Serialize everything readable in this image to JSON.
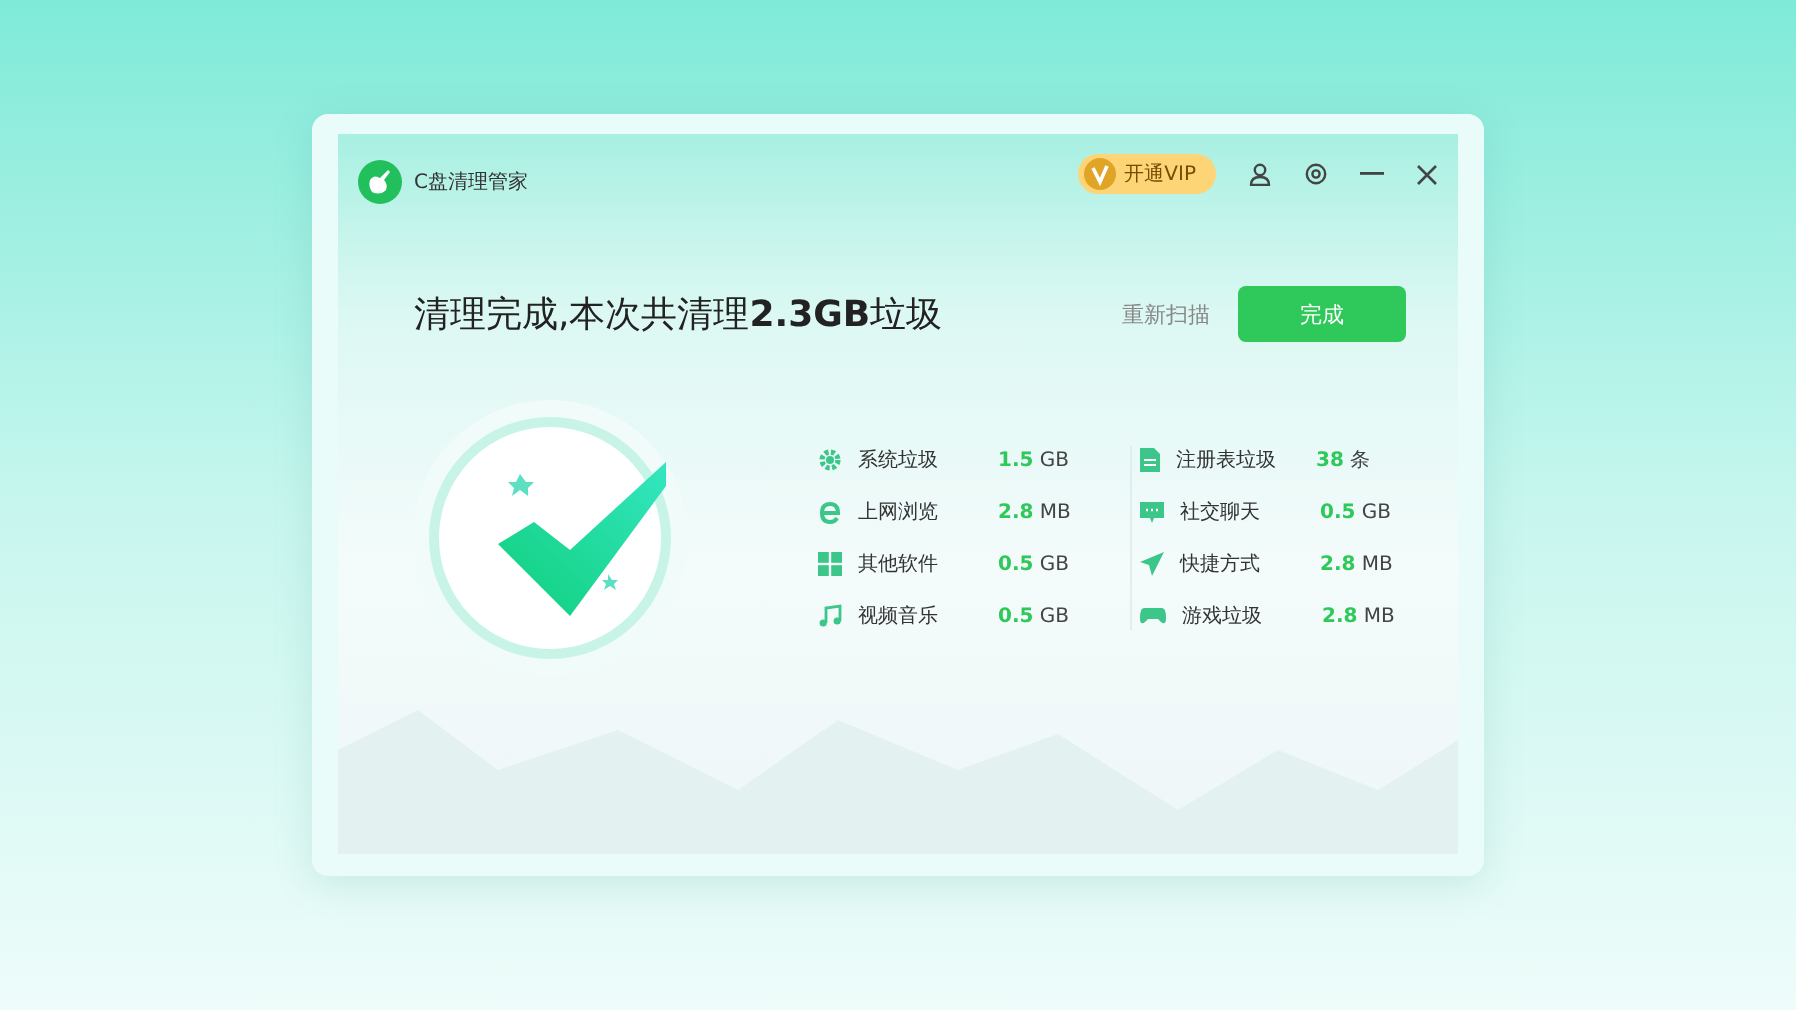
{
  "window": {
    "title": "C盘清理管家"
  },
  "vip_button": {
    "label": "开通VIP"
  },
  "headline": "清理完成,本次共清理**2.3GB**垃圾",
  "rescan_link": "重新扫描",
  "done_button": "完成",
  "items_left": [
    {
      "name": "系统垃圾",
      "value": "1.5",
      "unit": "GB"
    },
    {
      "name": "上网浏览",
      "value": "2.8",
      "unit": "MB"
    },
    {
      "name": "其他软件",
      "value": "0.5",
      "unit": "GB"
    },
    {
      "name": "视频音乐",
      "value": "0.5",
      "unit": "GB"
    }
  ],
  "items_right": [
    {
      "name": "注册表垃圾",
      "value": "38",
      "unit": "条"
    },
    {
      "name": "社交聊天",
      "value": "0.5",
      "unit": "GB"
    },
    {
      "name": "快捷方式",
      "value": "2.8",
      "unit": "MB"
    },
    {
      "name": "游戏垃圾",
      "value": "2.8",
      "unit": "MB"
    }
  ]
}
